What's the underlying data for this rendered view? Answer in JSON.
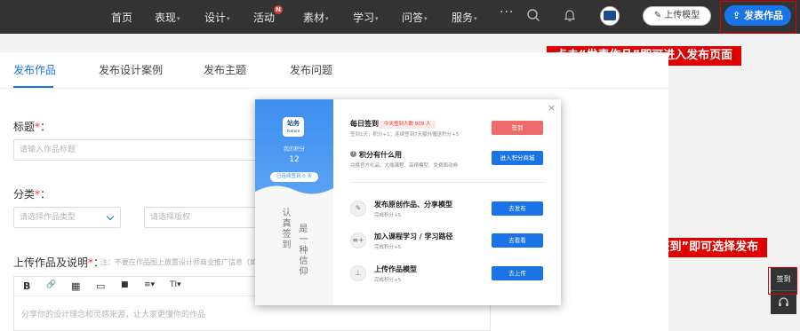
{
  "nav": {
    "items": [
      {
        "label": "首页",
        "caret": false
      },
      {
        "label": "表现",
        "caret": true
      },
      {
        "label": "设计",
        "caret": true
      },
      {
        "label": "活动",
        "caret": false,
        "badge": "N"
      },
      {
        "label": "素材",
        "caret": true
      },
      {
        "label": "学习",
        "caret": true
      },
      {
        "label": "问答",
        "caret": true
      },
      {
        "label": "服务",
        "caret": true
      }
    ],
    "more": "···",
    "upload_model": "上传模型",
    "publish": "发表作品"
  },
  "annotations": {
    "top": "点击“发表作品”即可进入发布页面",
    "bottom": "点击右下角导航“签到”即可选择发布"
  },
  "tabs": [
    "发布作品",
    "发布设计案例",
    "发布主题",
    "发布问题"
  ],
  "form": {
    "title_label": "标题",
    "title_placeholder": "请输入作品标题",
    "category_label": "分类",
    "category_placeholder": "请选择作品类型",
    "subcategory_placeholder": "请选择版权",
    "upload_label": "上传作品及说明",
    "upload_hint": "注：不要在作品图上放置设计师商业推广信息（如",
    "editor_placeholder": "分享你的设计理念和灵感来源，让大家更懂你的作品",
    "required_mark": "*",
    "colon": "："
  },
  "editor_tools": [
    "B",
    "🔗",
    "▦",
    "▭",
    "■",
    "≡▾",
    "TI▾"
  ],
  "modal": {
    "logo_text": "站务",
    "logo_sub": "feature",
    "points_label": "我的积分",
    "points_value": "12",
    "streak": "已连续签到 0 天",
    "calligraphy_a": "认真签到",
    "calligraphy_b": "是一种信仰",
    "checkin_title": "每日签到",
    "checkin_pill": "今天签到人数 909 人",
    "checkin_sub": "签到1天，积分+1；连续签到7天额外赠送积分+5",
    "checkin_button": "签到",
    "points_use_title": "积分有什么用",
    "points_use_sub": "兑换官方礼品、大咖课程、高精模型、免费面动券",
    "points_use_button": "进入积分商城",
    "tasks": [
      {
        "title": "发布原创作品、分享模型",
        "sub": "完成积分+5",
        "button": "去发布",
        "icon": "✎"
      },
      {
        "title": "加入课程学习 / 学习路径",
        "sub": "完成积分+5",
        "button": "去看看",
        "icon": "≡+"
      },
      {
        "title": "上传作品模型",
        "sub": "完成积分+5",
        "button": "去上传",
        "icon": "⊥"
      }
    ],
    "close": "×"
  },
  "dock": {
    "sign": "签到"
  },
  "colors": {
    "nav_bg": "#333333",
    "accent_blue": "#1a74e8",
    "annotation_red": "#e00000",
    "checkin_red": "#ef6b6b"
  }
}
